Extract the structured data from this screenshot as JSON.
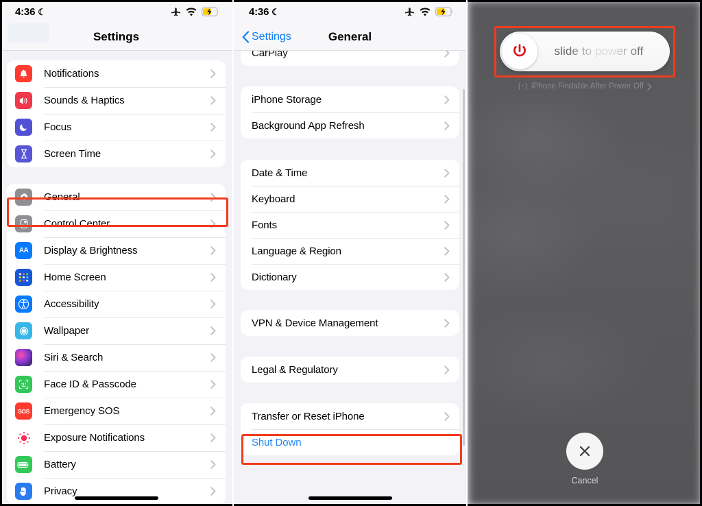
{
  "status_bar": {
    "time": "4:36",
    "moon_glyph": "☾",
    "icons": [
      "airplane-mode-icon",
      "wifi-icon",
      "battery-charging-icon"
    ]
  },
  "left_panel": {
    "nav_title": "Settings",
    "groups": [
      {
        "rows": [
          {
            "label": "Notifications",
            "icon": "notifications-icon",
            "icon_class": "ic-notifications",
            "glyph": "bell"
          },
          {
            "label": "Sounds & Haptics",
            "icon": "sounds-icon",
            "icon_class": "ic-sounds",
            "glyph": "speaker"
          },
          {
            "label": "Focus",
            "icon": "focus-icon",
            "icon_class": "ic-focus",
            "glyph": "moon"
          },
          {
            "label": "Screen Time",
            "icon": "screen-time-icon",
            "icon_class": "ic-screentime",
            "glyph": "hourglass"
          }
        ]
      },
      {
        "rows": [
          {
            "label": "General",
            "icon": "general-icon",
            "icon_class": "ic-general",
            "glyph": "gear",
            "highlighted": true
          },
          {
            "label": "Control Center",
            "icon": "control-center-icon",
            "icon_class": "ic-controlcenter",
            "glyph": "sliders"
          },
          {
            "label": "Display & Brightness",
            "icon": "display-brightness-icon",
            "icon_class": "ic-display",
            "glyph": "AA"
          },
          {
            "label": "Home Screen",
            "icon": "home-screen-icon",
            "icon_class": "ic-homescreen",
            "glyph": "grid"
          },
          {
            "label": "Accessibility",
            "icon": "accessibility-icon",
            "icon_class": "ic-accessibility",
            "glyph": "person"
          },
          {
            "label": "Wallpaper",
            "icon": "wallpaper-icon",
            "icon_class": "ic-wallpaper",
            "glyph": "flower"
          },
          {
            "label": "Siri & Search",
            "icon": "siri-icon",
            "icon_class": "ic-siri",
            "glyph": "orb"
          },
          {
            "label": "Face ID & Passcode",
            "icon": "face-id-icon",
            "icon_class": "ic-faceid",
            "glyph": "face"
          },
          {
            "label": "Emergency SOS",
            "icon": "emergency-sos-icon",
            "icon_class": "ic-sos",
            "glyph": "SOS"
          },
          {
            "label": "Exposure Notifications",
            "icon": "exposure-notifications-icon",
            "icon_class": "ic-exposure",
            "glyph": "radiate"
          },
          {
            "label": "Battery",
            "icon": "battery-icon",
            "icon_class": "ic-battery",
            "glyph": "battery"
          },
          {
            "label": "Privacy",
            "icon": "privacy-icon",
            "icon_class": "ic-privacy",
            "glyph": "hand"
          }
        ]
      }
    ]
  },
  "mid_panel": {
    "back_label": "Settings",
    "nav_title": "General",
    "groups": [
      {
        "rows": [
          {
            "label": "CarPlay"
          }
        ]
      },
      {
        "rows": [
          {
            "label": "iPhone Storage"
          },
          {
            "label": "Background App Refresh"
          }
        ]
      },
      {
        "rows": [
          {
            "label": "Date & Time"
          },
          {
            "label": "Keyboard"
          },
          {
            "label": "Fonts"
          },
          {
            "label": "Language & Region"
          },
          {
            "label": "Dictionary"
          }
        ]
      },
      {
        "rows": [
          {
            "label": "VPN & Device Management"
          }
        ]
      },
      {
        "rows": [
          {
            "label": "Legal & Regulatory"
          }
        ]
      },
      {
        "rows": [
          {
            "label": "Transfer or Reset iPhone"
          },
          {
            "label": "Shut Down",
            "link": true,
            "highlighted": true
          }
        ]
      }
    ]
  },
  "right_panel": {
    "slider_text": "slide to power off",
    "power_icon": "power-icon",
    "findable_text": "iPhone Findable After Power Off",
    "cancel_label": "Cancel",
    "cancel_icon": "close-icon"
  },
  "colors": {
    "highlight_red": "#f03c1e",
    "ios_blue": "#1f83f5",
    "power_red": "#d8131a",
    "list_bg": "#f2f2f7",
    "overlay_gray": "#59595c"
  }
}
